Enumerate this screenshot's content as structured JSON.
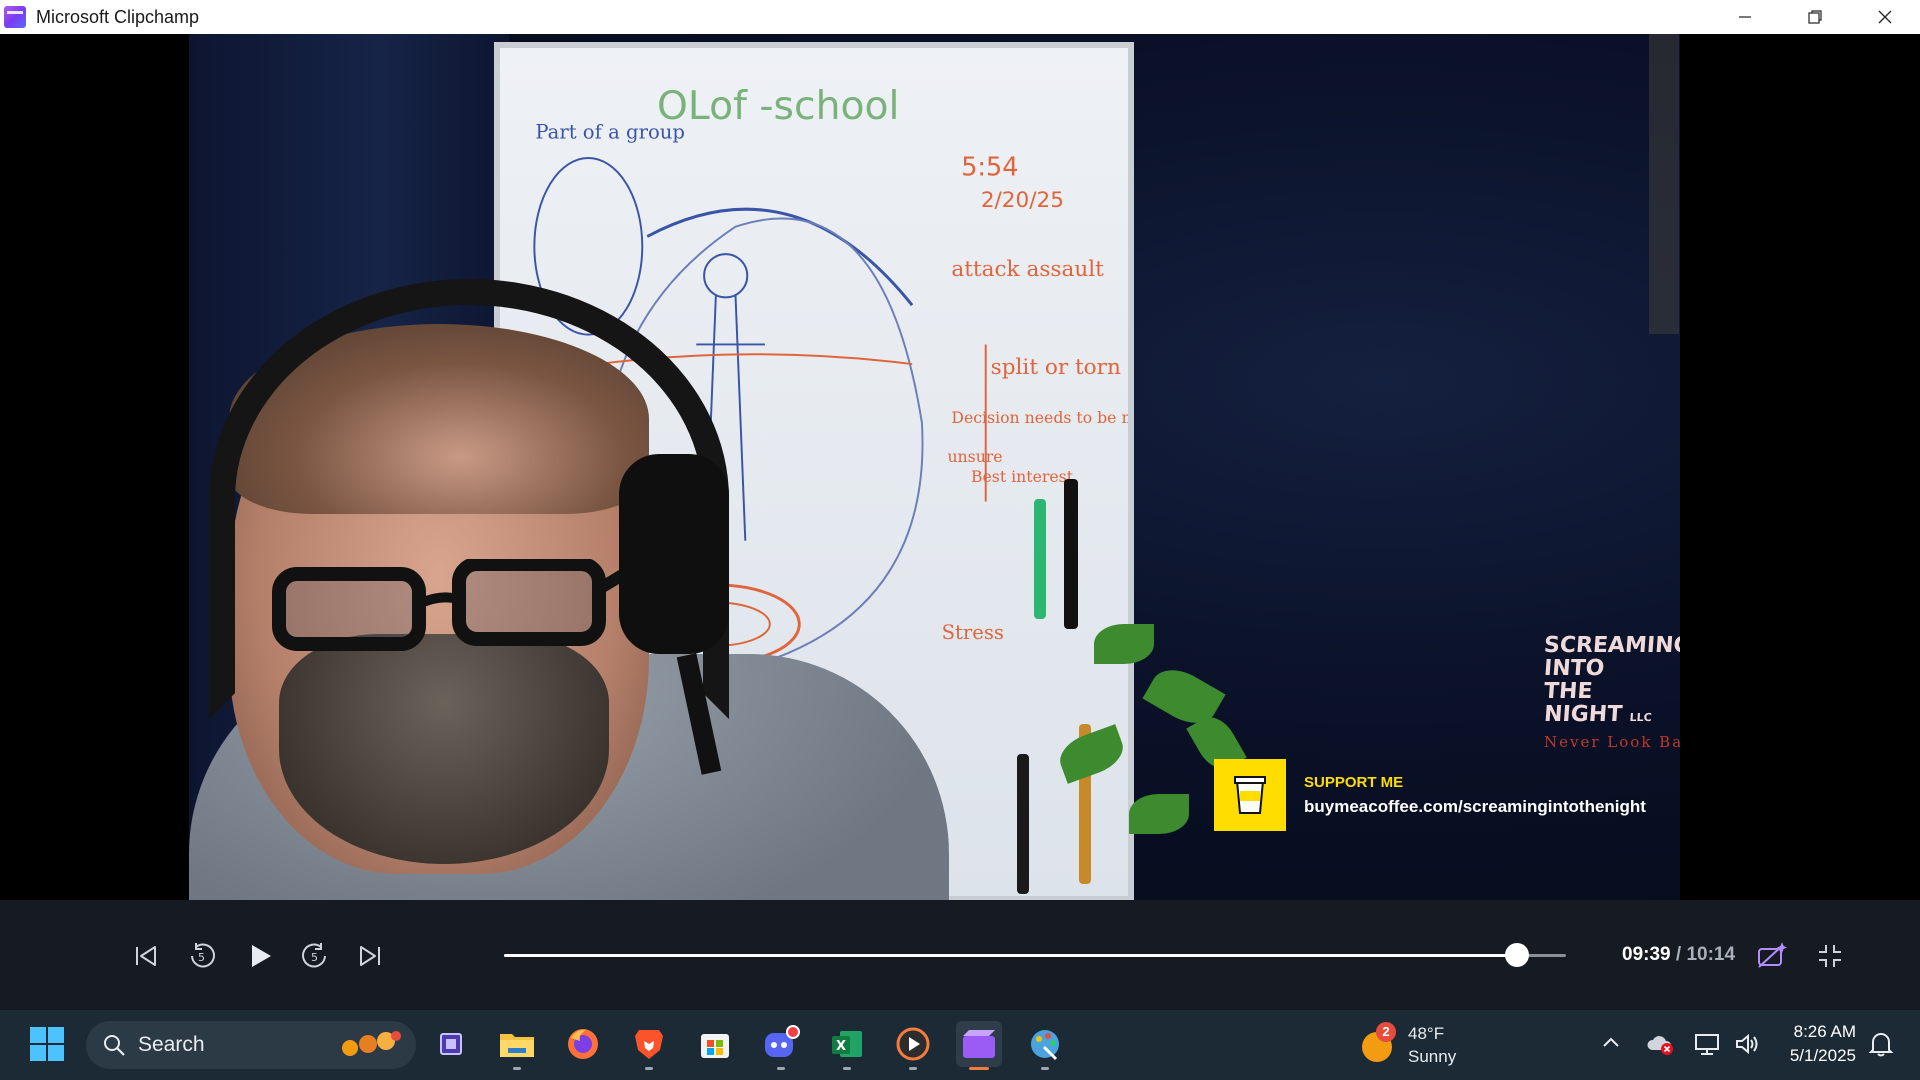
{
  "window": {
    "title": "Microsoft Clipchamp",
    "controls": [
      "minimize-icon",
      "restore-icon",
      "close-icon"
    ]
  },
  "video": {
    "whiteboard": {
      "title": "OLof -school",
      "time": "5:54",
      "date": "2/20/25",
      "notes": [
        "Part of a group",
        "attack assault",
        "split or torn",
        "Decision needs to be made",
        "unsure",
        "Best interest",
        "Stress"
      ]
    },
    "logo": {
      "lines": [
        "SCREAMING",
        "INTO",
        "THE",
        "NIGHT"
      ],
      "suffix": "LLC",
      "tagline": "Never Look Ba"
    },
    "support": {
      "title": "SUPPORT ME",
      "url": "buymeacoffee.com/screamingintothenight"
    }
  },
  "player": {
    "current_time": "09:39",
    "separator": "/",
    "total_time": "10:14",
    "progress": 0.954,
    "buttons": [
      "skip-back-icon",
      "rewind-5-icon",
      "play-icon",
      "forward-5-icon",
      "skip-forward-icon"
    ],
    "rewind_label": "5",
    "forward_label": "5"
  },
  "taskbar": {
    "search_placeholder": "Search",
    "weather": {
      "temp": "48°F",
      "condition": "Sunny",
      "badge": "2"
    },
    "clock": {
      "time": "8:26 AM",
      "date": "5/1/2025"
    },
    "colors": {
      "background": "#1c2a35",
      "accent_clipchamp": "#7a3cf0",
      "discord": "#5865f2",
      "excel": "#1f7a45",
      "firefox": "#ff7139",
      "brave": "#fb542b"
    }
  }
}
